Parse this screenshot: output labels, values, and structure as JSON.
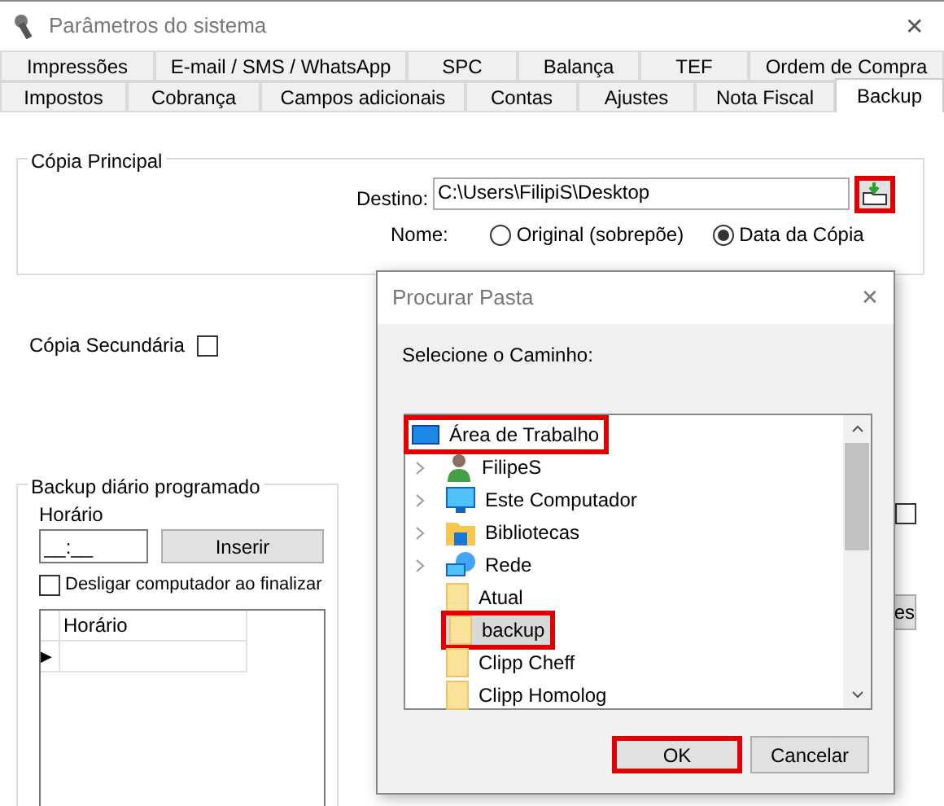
{
  "window": {
    "title": "Parâmetros do sistema",
    "close": "✕"
  },
  "tab_rows": [
    [
      {
        "label": "Impressões",
        "selected": false
      },
      {
        "label": "E-mail / SMS / WhatsApp",
        "selected": false
      },
      {
        "label": "SPC",
        "selected": false
      },
      {
        "label": "Balança",
        "selected": false
      },
      {
        "label": "TEF",
        "selected": false
      },
      {
        "label": "Ordem de Compra",
        "selected": false
      }
    ],
    [
      {
        "label": "Impostos",
        "selected": false
      },
      {
        "label": "Cobrança",
        "selected": false
      },
      {
        "label": "Campos adicionais",
        "selected": false
      },
      {
        "label": "Contas",
        "selected": false
      },
      {
        "label": "Ajustes",
        "selected": false
      },
      {
        "label": "Nota Fiscal",
        "selected": false
      },
      {
        "label": "Backup",
        "selected": true
      }
    ]
  ],
  "primary_copy": {
    "title": "Cópia Principal",
    "destination_label": "Destino:",
    "destination": "C:\\Users\\FilipiS\\Desktop",
    "browse_highlighted": true,
    "name_label": "Nome:",
    "options": [
      {
        "label": "Original (sobrepõe)",
        "selected": false
      },
      {
        "label": "Data da Cópia",
        "selected": true
      }
    ]
  },
  "secondary_copy": {
    "label": "Cópia Secundária",
    "checked": false
  },
  "daily_backup": {
    "title": "Backup diário programado",
    "time_label": "Horário",
    "time_placeholder": "__:__",
    "insert_button": "Inserir",
    "shutdown": {
      "label": "Desligar computador ao finalizar",
      "checked": false
    },
    "grid_column": "Horário",
    "row_marker": "▶"
  },
  "hidden_checkbox": {
    "checked": false
  },
  "hidden_button": "es",
  "dialog": {
    "title": "Procurar Pasta",
    "close": "✕",
    "prompt": "Selecione o Caminho:",
    "items": [
      {
        "label": "Área de Trabalho",
        "kind": "desktop",
        "expandable": false,
        "selected": false,
        "highlighted": true,
        "indent": false
      },
      {
        "label": "FilipeS",
        "kind": "user",
        "expandable": true,
        "selected": false,
        "highlighted": false,
        "indent": true
      },
      {
        "label": "Este Computador",
        "kind": "computer",
        "expandable": true,
        "selected": false,
        "highlighted": false,
        "indent": true
      },
      {
        "label": "Bibliotecas",
        "kind": "library",
        "expandable": true,
        "selected": false,
        "highlighted": false,
        "indent": true
      },
      {
        "label": "Rede",
        "kind": "network",
        "expandable": true,
        "selected": false,
        "highlighted": false,
        "indent": true
      },
      {
        "label": "Atual",
        "kind": "folder",
        "expandable": false,
        "selected": false,
        "highlighted": false,
        "indent": true
      },
      {
        "label": "backup",
        "kind": "folder",
        "expandable": false,
        "selected": true,
        "highlighted": true,
        "indent": true
      },
      {
        "label": "Clipp Cheff",
        "kind": "folder",
        "expandable": false,
        "selected": false,
        "highlighted": false,
        "indent": true
      },
      {
        "label": "Clipp Homolog",
        "kind": "folder",
        "expandable": false,
        "selected": false,
        "highlighted": false,
        "indent": true
      }
    ],
    "ok": {
      "label": "OK",
      "highlighted": true
    },
    "cancel": "Cancelar"
  }
}
